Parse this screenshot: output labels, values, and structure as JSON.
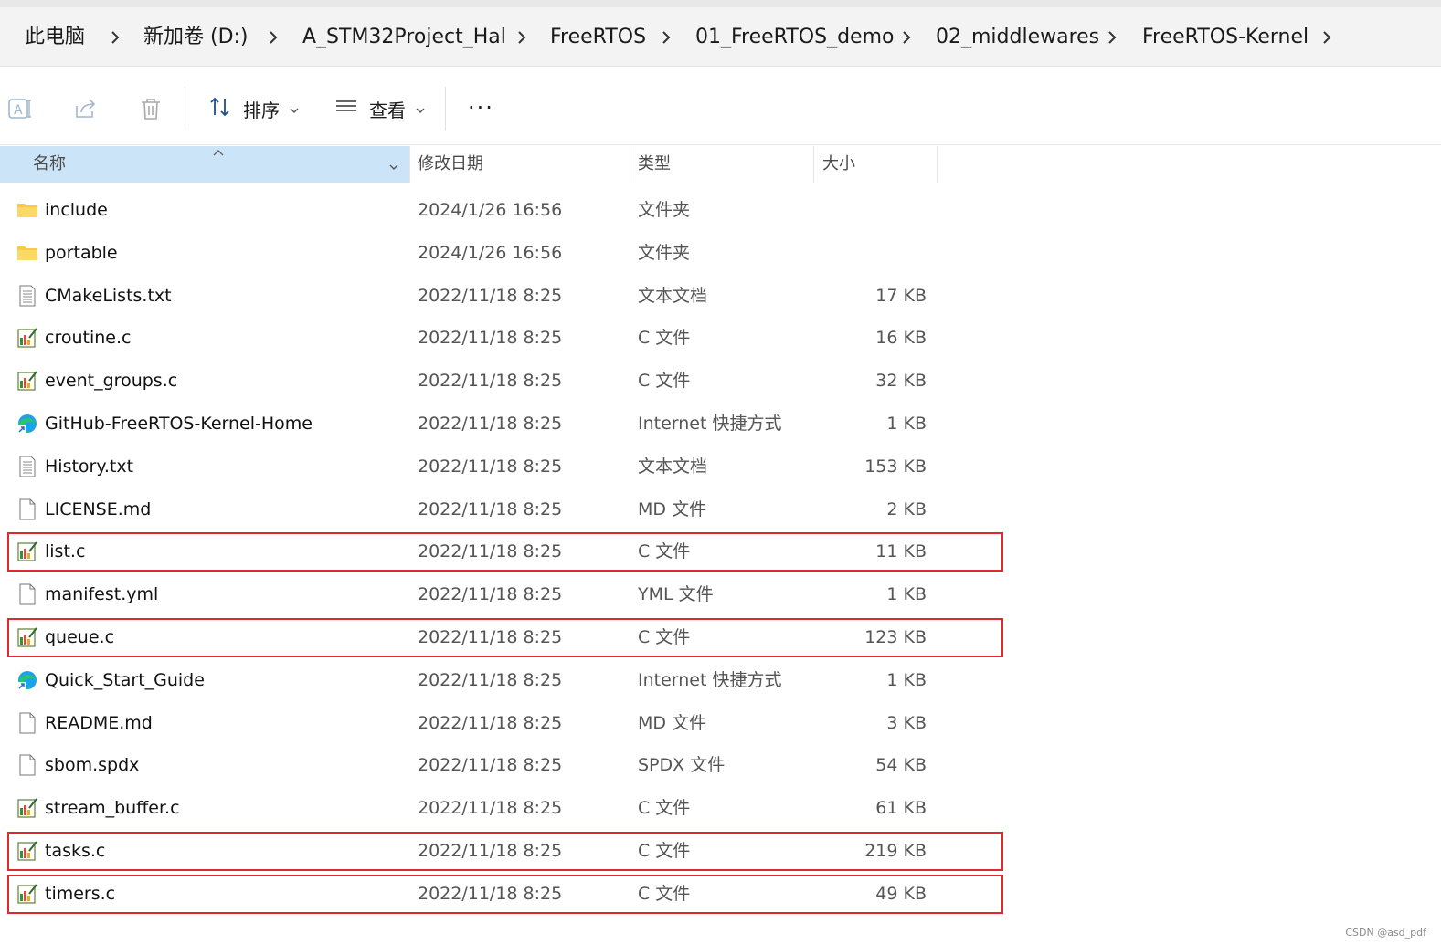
{
  "breadcrumb": [
    "此电脑",
    "新加卷 (D:)",
    "A_STM32Project_Hal",
    "FreeRTOS",
    "01_FreeRTOS_demo",
    "02_middlewares",
    "FreeRTOS-Kernel"
  ],
  "toolbar": {
    "rename_icon": "rename-icon",
    "share_icon": "share-icon",
    "delete_icon": "trash-icon",
    "sort_label": "排序",
    "view_label": "查看",
    "more_label": "···"
  },
  "columns": {
    "name": "名称",
    "date": "修改日期",
    "type": "类型",
    "size": "大小"
  },
  "files": [
    {
      "name": "include",
      "date": "2024/1/26 16:56",
      "type": "文件夹",
      "size": "",
      "icon": "folder"
    },
    {
      "name": "portable",
      "date": "2024/1/26 16:56",
      "type": "文件夹",
      "size": "",
      "icon": "folder"
    },
    {
      "name": "CMakeLists.txt",
      "date": "2022/11/18 8:25",
      "type": "文本文档",
      "size": "17 KB",
      "icon": "text"
    },
    {
      "name": "croutine.c",
      "date": "2022/11/18 8:25",
      "type": "C 文件",
      "size": "16 KB",
      "icon": "c"
    },
    {
      "name": "event_groups.c",
      "date": "2022/11/18 8:25",
      "type": "C 文件",
      "size": "32 KB",
      "icon": "c"
    },
    {
      "name": "GitHub-FreeRTOS-Kernel-Home",
      "date": "2022/11/18 8:25",
      "type": "Internet 快捷方式",
      "size": "1 KB",
      "icon": "url"
    },
    {
      "name": "History.txt",
      "date": "2022/11/18 8:25",
      "type": "文本文档",
      "size": "153 KB",
      "icon": "text"
    },
    {
      "name": "LICENSE.md",
      "date": "2022/11/18 8:25",
      "type": "MD 文件",
      "size": "2 KB",
      "icon": "blank"
    },
    {
      "name": "list.c",
      "date": "2022/11/18 8:25",
      "type": "C 文件",
      "size": "11 KB",
      "icon": "c",
      "highlighted": true
    },
    {
      "name": "manifest.yml",
      "date": "2022/11/18 8:25",
      "type": "YML 文件",
      "size": "1 KB",
      "icon": "blank"
    },
    {
      "name": "queue.c",
      "date": "2022/11/18 8:25",
      "type": "C 文件",
      "size": "123 KB",
      "icon": "c",
      "highlighted": true
    },
    {
      "name": "Quick_Start_Guide",
      "date": "2022/11/18 8:25",
      "type": "Internet 快捷方式",
      "size": "1 KB",
      "icon": "url"
    },
    {
      "name": "README.md",
      "date": "2022/11/18 8:25",
      "type": "MD 文件",
      "size": "3 KB",
      "icon": "blank"
    },
    {
      "name": "sbom.spdx",
      "date": "2022/11/18 8:25",
      "type": "SPDX 文件",
      "size": "54 KB",
      "icon": "blank"
    },
    {
      "name": "stream_buffer.c",
      "date": "2022/11/18 8:25",
      "type": "C 文件",
      "size": "61 KB",
      "icon": "c"
    },
    {
      "name": "tasks.c",
      "date": "2022/11/18 8:25",
      "type": "C 文件",
      "size": "219 KB",
      "icon": "c",
      "highlighted": true
    },
    {
      "name": "timers.c",
      "date": "2022/11/18 8:25",
      "type": "C 文件",
      "size": "49 KB",
      "icon": "c",
      "highlighted": true
    }
  ],
  "colors": {
    "header_selected": "#cce4f7",
    "highlight_border": "#e0282e",
    "folder": "#f8c94a"
  },
  "watermark": "CSDN @asd_pdf"
}
